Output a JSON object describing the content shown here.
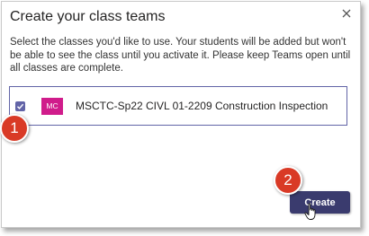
{
  "dialog": {
    "title": "Create your class teams",
    "description": "Select the classes you'd like to use. Your students will be added but won't be able to see the class until you activate it. Please keep Teams open until all classes are complete.",
    "classes": [
      {
        "checked": true,
        "avatar_text": "MC",
        "avatar_color": "#d01c8b",
        "name": "MSCTC-Sp22 CIVL 01-2209 Construction Inspection"
      }
    ],
    "create_label": "Create"
  },
  "annotations": {
    "step1": "1",
    "step2": "2",
    "badge_color": "#d93a26"
  },
  "colors": {
    "accent": "#6264a7",
    "button": "#3a3b6e"
  },
  "icons": {
    "close": "close-icon",
    "check": "check-icon",
    "cursor": "hand-pointer-icon"
  }
}
